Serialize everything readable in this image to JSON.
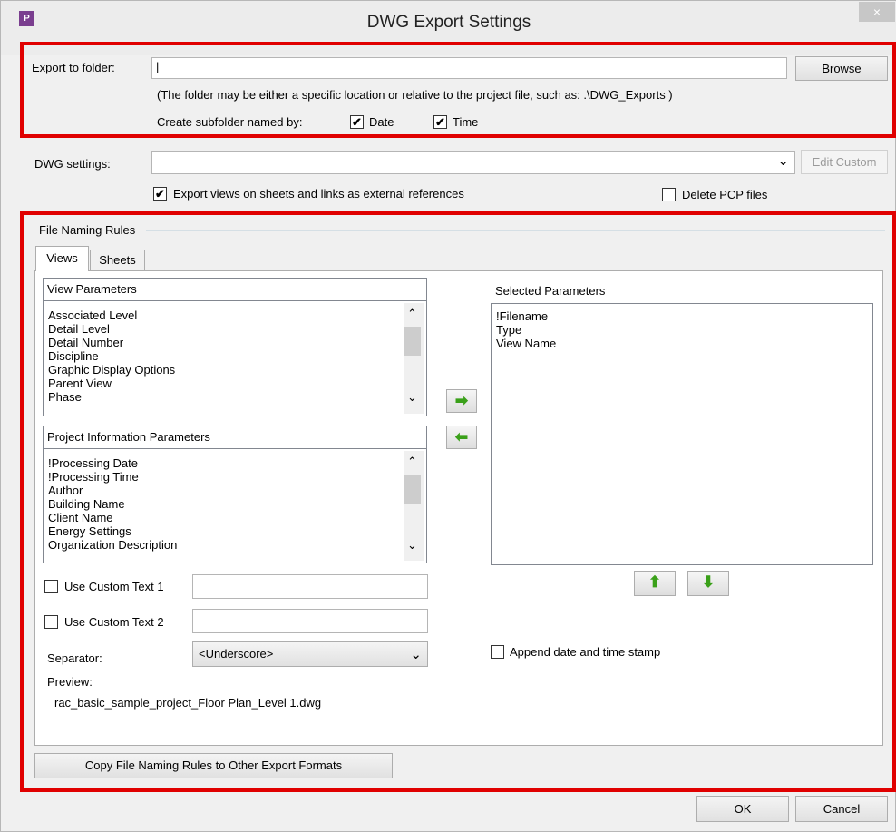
{
  "window": {
    "title": "DWG Export Settings",
    "app_icon": "P",
    "close_glyph": "×"
  },
  "export": {
    "folder_label": "Export to folder:",
    "folder_value": "|",
    "browse_label": "Browse",
    "hint": "(The folder may be either a specific location or relative to the project file, such as:  .\\DWG_Exports )",
    "subfolder_label": "Create subfolder named by:",
    "date_label": "Date",
    "date_checked": true,
    "time_label": "Time",
    "time_checked": true
  },
  "dwg": {
    "settings_label": "DWG settings:",
    "settings_value": "",
    "edit_custom_label": "Edit Custom",
    "xref_label": "Export views on sheets and links as external references",
    "xref_checked": true,
    "delete_pcp_label": "Delete PCP files",
    "delete_pcp_checked": false
  },
  "naming": {
    "group_label": "File Naming Rules",
    "tabs": [
      "Views",
      "Sheets"
    ],
    "view_params_label": "View Parameters",
    "view_params": [
      "Associated Level",
      "Detail Level",
      "Detail Number",
      "Discipline",
      "Graphic Display Options",
      "Parent View",
      "Phase"
    ],
    "project_params_label": "Project Information Parameters",
    "project_params": [
      "!Processing Date",
      "!Processing Time",
      "Author",
      "Building Name",
      "Client Name",
      "Energy Settings",
      "Organization Description"
    ],
    "selected_label": "Selected Parameters",
    "selected_params": [
      "!Filename",
      "Type",
      "View Name"
    ],
    "custom1_label": "Use Custom Text 1",
    "custom2_label": "Use Custom Text 2",
    "separator_label": "Separator:",
    "separator_value": "<Underscore>",
    "append_label": "Append date and time stamp",
    "preview_label": "Preview:",
    "preview_value": "rac_basic_sample_project_Floor Plan_Level 1.dwg",
    "copy_rules_label": "Copy File Naming Rules to Other Export Formats",
    "arrow_add": "➡",
    "arrow_remove": "⬅",
    "arrow_up": "⬆",
    "arrow_down": "⬇"
  },
  "footer": {
    "ok_label": "OK",
    "cancel_label": "Cancel"
  },
  "check_glyph": "✔",
  "dropdown_glyph": "⌄",
  "scroll_up_glyph": "⌃",
  "scroll_down_glyph": "⌄"
}
